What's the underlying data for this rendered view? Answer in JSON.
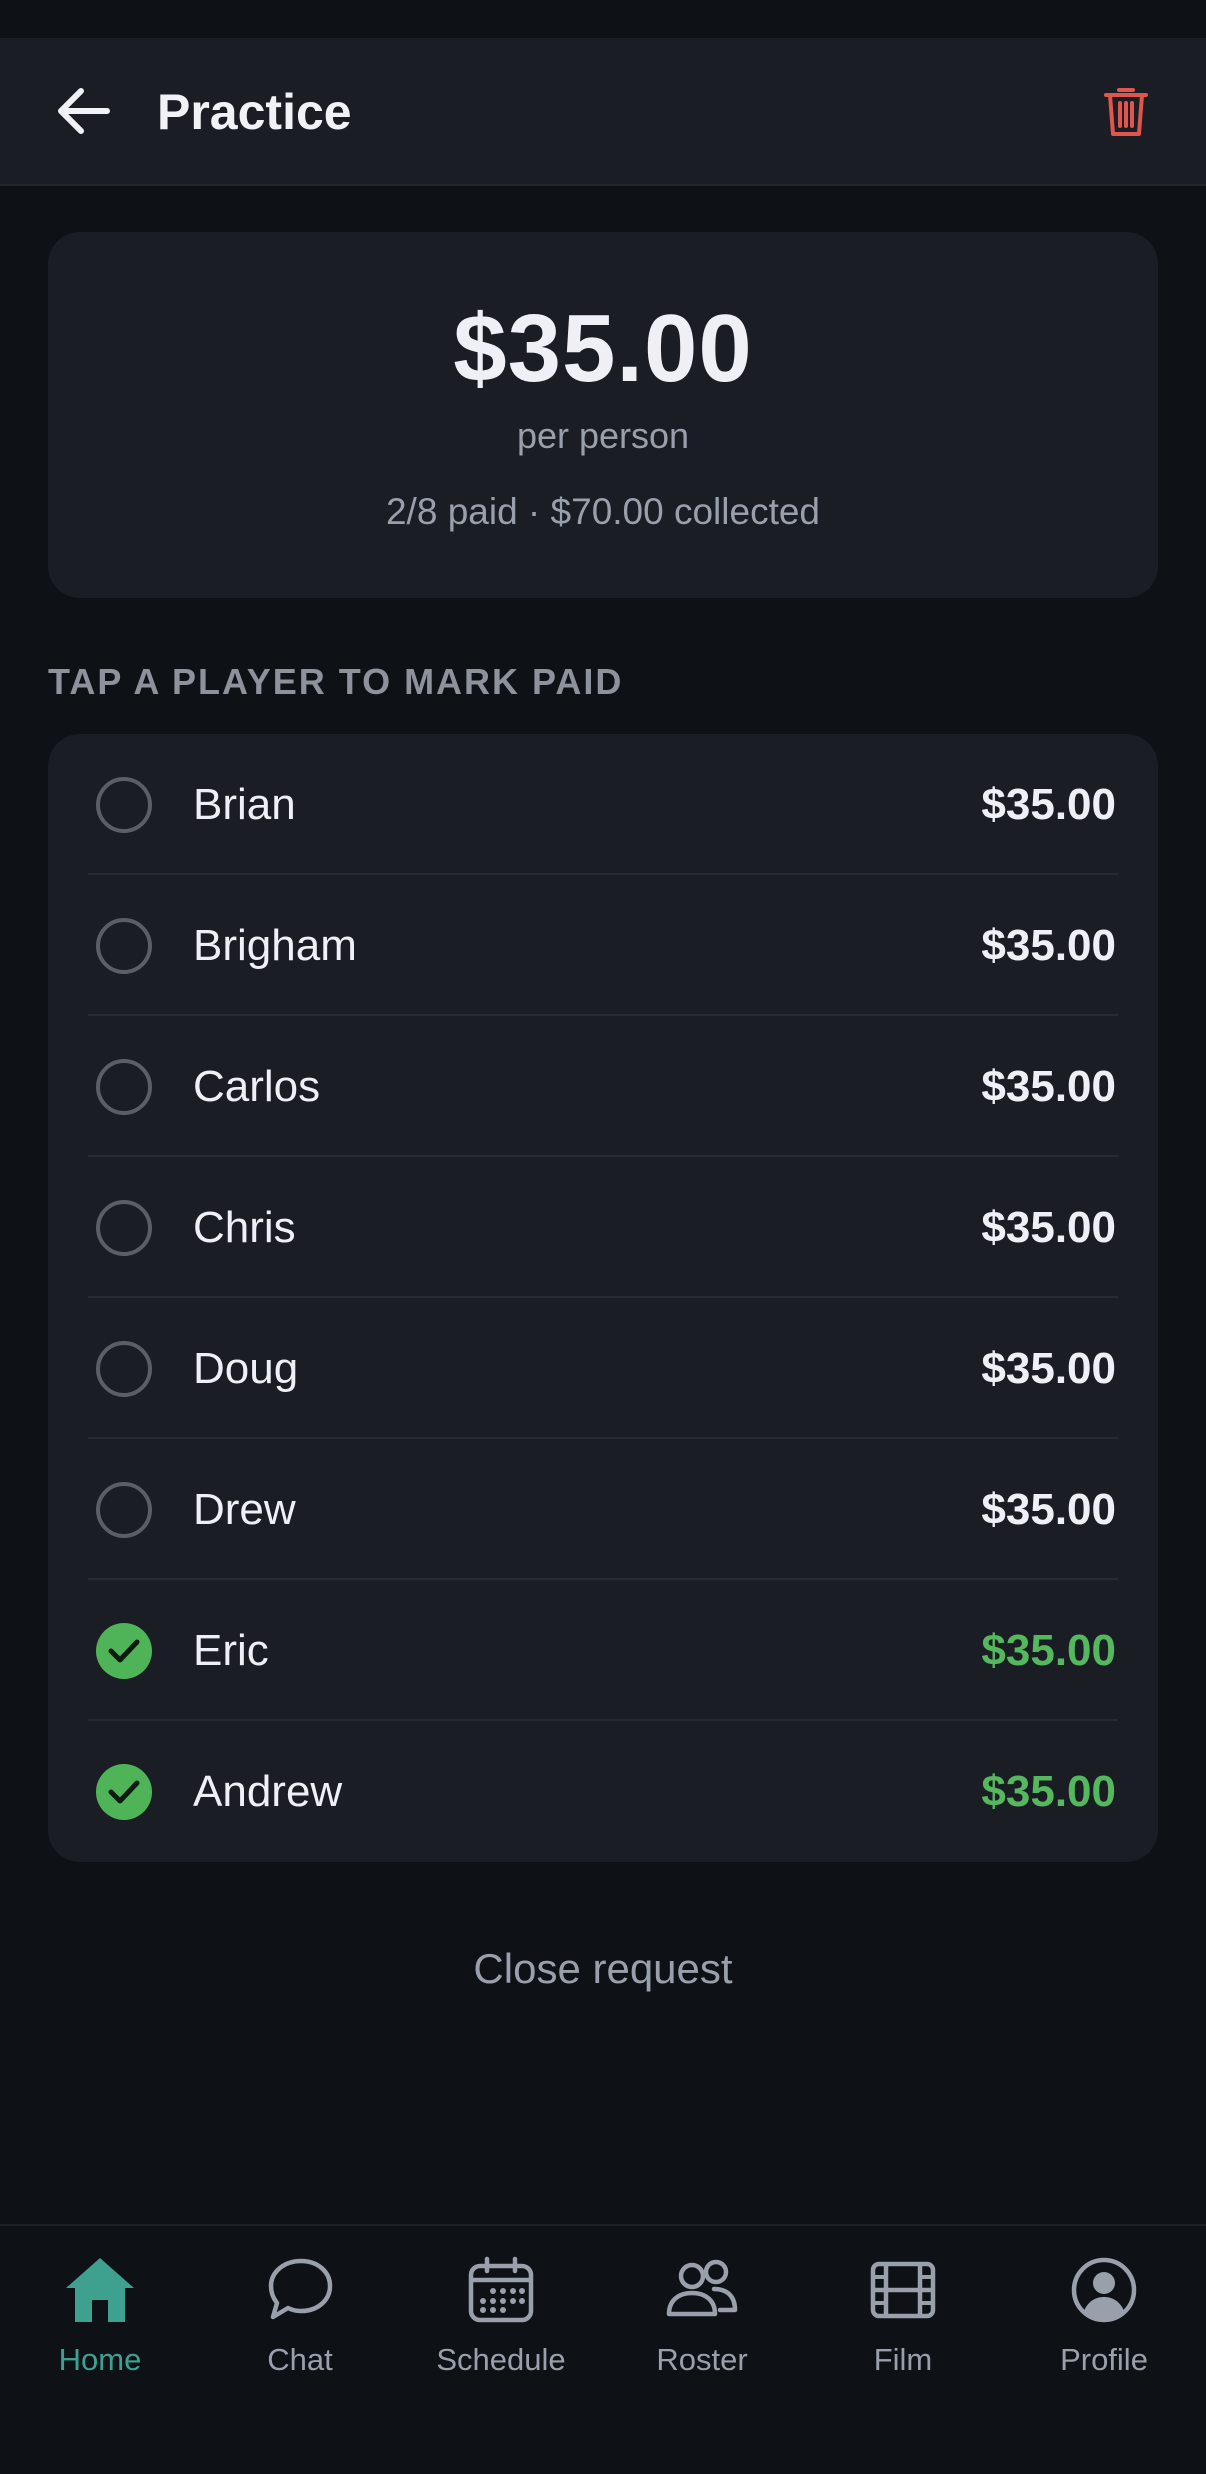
{
  "header": {
    "title": "Practice"
  },
  "summary": {
    "amount": "$35.00",
    "per_person": "per person",
    "paid_summary": "2/8 paid · $70.00 collected"
  },
  "section_label": "TAP A PLAYER TO MARK PAID",
  "players": [
    {
      "name": "Brian",
      "amount": "$35.00",
      "paid": false
    },
    {
      "name": "Brigham",
      "amount": "$35.00",
      "paid": false
    },
    {
      "name": "Carlos",
      "amount": "$35.00",
      "paid": false
    },
    {
      "name": "Chris",
      "amount": "$35.00",
      "paid": false
    },
    {
      "name": "Doug",
      "amount": "$35.00",
      "paid": false
    },
    {
      "name": "Drew",
      "amount": "$35.00",
      "paid": false
    },
    {
      "name": "Eric",
      "amount": "$35.00",
      "paid": true
    },
    {
      "name": "Andrew",
      "amount": "$35.00",
      "paid": true
    }
  ],
  "close_request": "Close request",
  "tabs": [
    {
      "label": "Home",
      "icon": "home-icon",
      "active": true
    },
    {
      "label": "Chat",
      "icon": "chat-icon",
      "active": false
    },
    {
      "label": "Schedule",
      "icon": "calendar-icon",
      "active": false
    },
    {
      "label": "Roster",
      "icon": "users-icon",
      "active": false
    },
    {
      "label": "Film",
      "icon": "film-icon",
      "active": false
    },
    {
      "label": "Profile",
      "icon": "profile-icon",
      "active": false
    }
  ],
  "colors": {
    "accent": "#3ea08f",
    "paid_green": "#4fb358",
    "danger": "#e0564f",
    "card_bg": "#1a1d24",
    "page_bg": "#0e1116"
  }
}
